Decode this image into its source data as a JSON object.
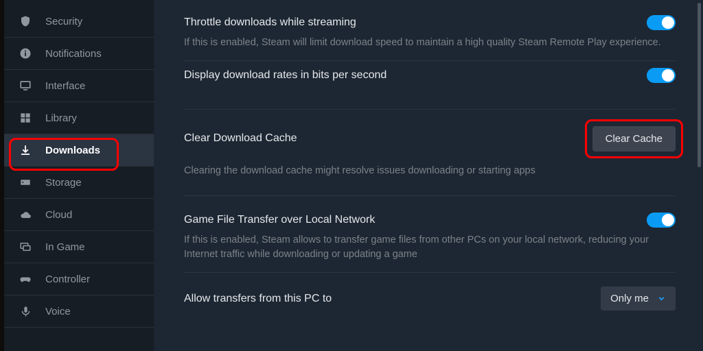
{
  "sidebar": [
    {
      "label": "Security"
    },
    {
      "label": "Notifications"
    },
    {
      "label": "Interface"
    },
    {
      "label": "Library"
    },
    {
      "label": "Downloads"
    },
    {
      "label": "Storage"
    },
    {
      "label": "Cloud"
    },
    {
      "label": "In Game"
    },
    {
      "label": "Controller"
    },
    {
      "label": "Voice"
    }
  ],
  "settings": {
    "throttle": {
      "title": "Throttle downloads while streaming",
      "desc": "If this is enabled, Steam will limit download speed to maintain a high quality Steam Remote Play experience."
    },
    "bits": {
      "title": "Display download rates in bits per second"
    },
    "cache": {
      "title": "Clear Download Cache",
      "button": "Clear Cache",
      "desc": "Clearing the download cache might resolve issues downloading or starting apps"
    },
    "lan": {
      "title": "Game File Transfer over Local Network",
      "desc": "If this is enabled, Steam allows to transfer game files from other PCs on your local network, reducing your Internet traffic while downloading or updating a game"
    },
    "allow": {
      "title": "Allow transfers from this PC to",
      "value": "Only me"
    }
  }
}
